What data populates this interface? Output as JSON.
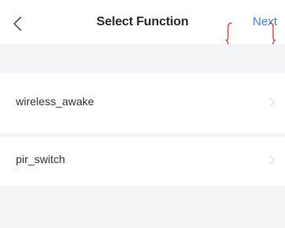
{
  "header": {
    "title": "Select Function",
    "next_label": "Next",
    "back_icon": "chevron-left-icon",
    "accent_color": "#3d7ee8",
    "annotation_color": "#d9362b"
  },
  "functions": [
    {
      "label": "wireless_awake",
      "icon": "chevron-right-icon"
    },
    {
      "label": "pir_switch",
      "icon": "chevron-right-icon"
    }
  ],
  "colors": {
    "background": "#f3f4f6",
    "row": "#ffffff",
    "text": "#333333",
    "chevron": "#e0e0e0"
  }
}
